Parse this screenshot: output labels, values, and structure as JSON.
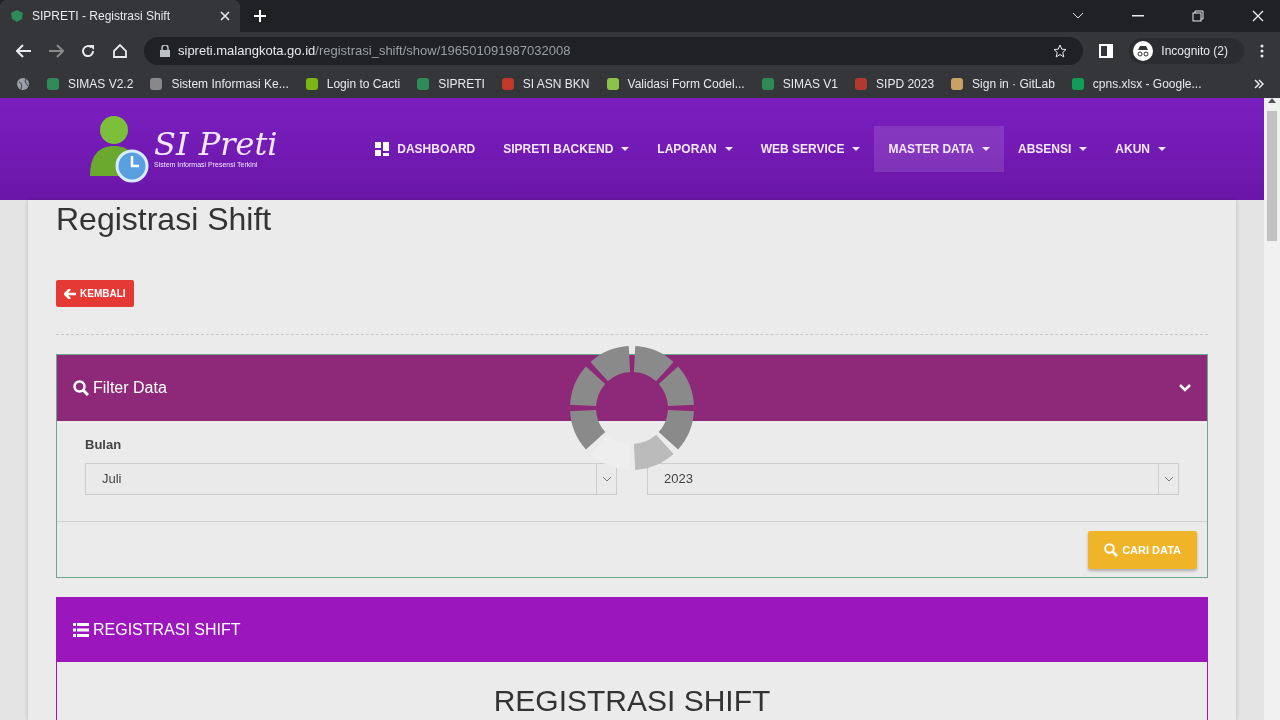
{
  "browser": {
    "tab_title": "SIPRETI - Registrasi Shift",
    "url_host": "sipreti.malangkota.go.id",
    "url_path": "/registrasi_shift/show/196501091987032008",
    "profile": "Incognito (2)",
    "bookmarks": [
      {
        "label": "SIMAS V2.2",
        "color": "#2e8b57"
      },
      {
        "label": "Sistem Informasi Ke...",
        "color": "#888888"
      },
      {
        "label": "Login to Cacti",
        "color": "#7cb518"
      },
      {
        "label": "SIPRETI",
        "color": "#2e8b57"
      },
      {
        "label": "SI ASN BKN",
        "color": "#c0392b"
      },
      {
        "label": "Validasi Form Codel...",
        "color": "#8bc34a"
      },
      {
        "label": "SIMAS V1",
        "color": "#2e8b57"
      },
      {
        "label": "SIPD 2023",
        "color": "#b03a2e"
      },
      {
        "label": "Sign in · GitLab",
        "color": "#c8a165"
      },
      {
        "label": "cpns.xlsx - Google...",
        "color": "#0f9d58"
      }
    ]
  },
  "navbar": {
    "logo_title": "SI Preti",
    "logo_subtitle": "Sistem Informasi Presensi Terkini",
    "items": [
      {
        "label": "DASHBOARD",
        "kind": "icon",
        "selected": false
      },
      {
        "label": "SIPRETI BACKEND",
        "kind": "dropdown",
        "selected": false
      },
      {
        "label": "LAPORAN",
        "kind": "dropdown",
        "selected": false
      },
      {
        "label": "WEB SERVICE",
        "kind": "dropdown",
        "selected": false
      },
      {
        "label": "MASTER DATA",
        "kind": "dropdown",
        "selected": true
      },
      {
        "label": "ABSENSI",
        "kind": "dropdown",
        "selected": false
      },
      {
        "label": "AKUN",
        "kind": "dropdown",
        "selected": false
      }
    ]
  },
  "page_title": "Registrasi Shift",
  "back_button": "KEMBALI",
  "filter_panel": {
    "title": "Filter Data",
    "fields": [
      {
        "label": "Bulan",
        "value": "Juli"
      },
      {
        "value": "2023"
      }
    ],
    "button": "CARI DATA"
  },
  "registrasi_panel": {
    "title": "REGISTRASI SHIFT",
    "heading": "REGISTRASI SHIFT"
  }
}
